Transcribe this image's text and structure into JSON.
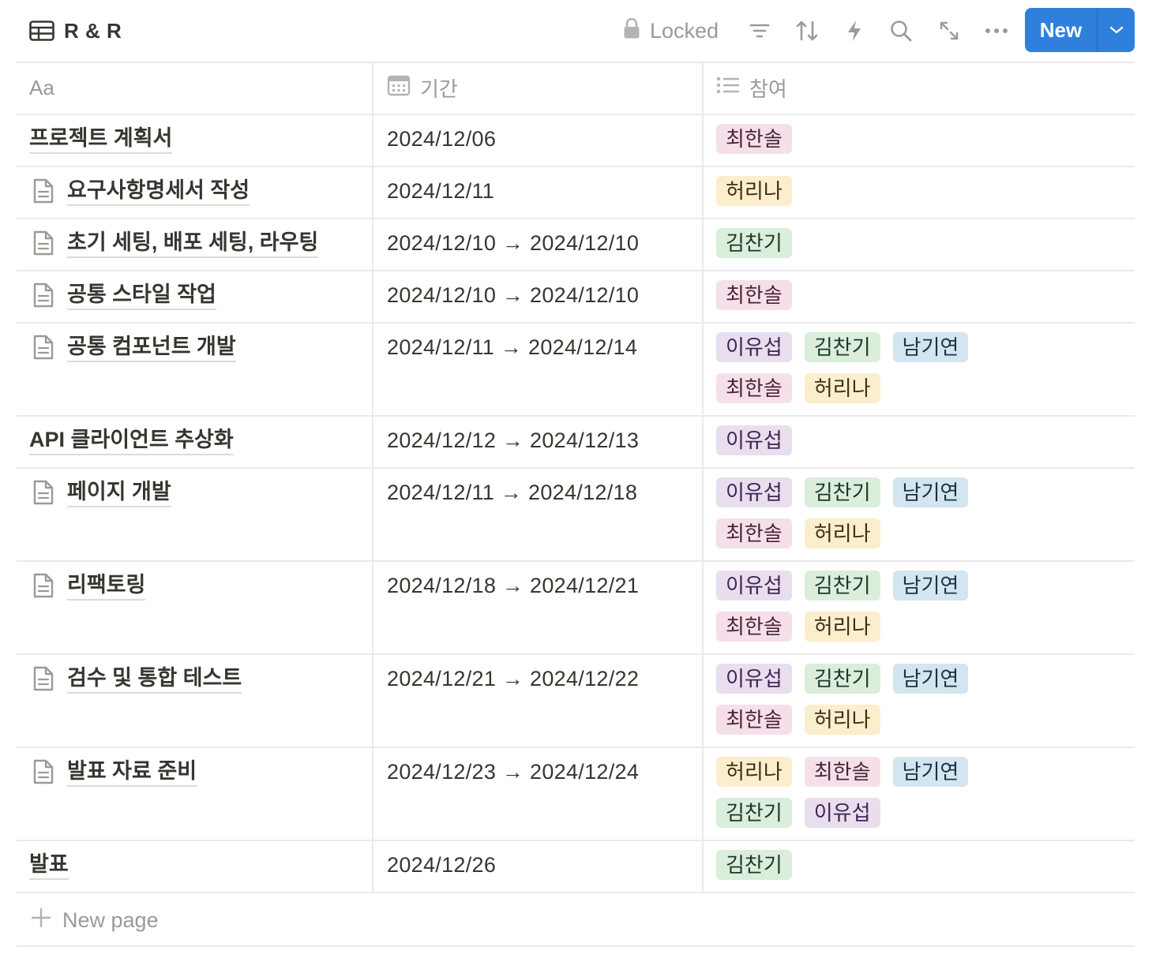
{
  "header": {
    "title": "R & R",
    "locked_label": "Locked",
    "new_button_label": "New"
  },
  "columns": {
    "name_header": "Aa",
    "date_header": "기간",
    "members_header": "참여"
  },
  "tag_colors": {
    "이유섭": {
      "bg": "#e8deee",
      "fg": "#412454"
    },
    "김찬기": {
      "bg": "#dbeddb",
      "fg": "#1c3829"
    },
    "남기연": {
      "bg": "#d3e5ef",
      "fg": "#183347"
    },
    "최한솔": {
      "bg": "#f5e0e9",
      "fg": "#4c2337"
    },
    "허리나": {
      "bg": "#fbeecc",
      "fg": "#402c1b"
    }
  },
  "rows": [
    {
      "name": "프로젝트 계획서",
      "has_icon": false,
      "date": "2024/12/06",
      "members": [
        "최한솔"
      ]
    },
    {
      "name": "요구사항명세서 작성",
      "has_icon": true,
      "date": "2024/12/11",
      "members": [
        "허리나"
      ]
    },
    {
      "name": "초기 세팅, 배포 세팅, 라우팅",
      "has_icon": true,
      "date": "2024/12/10 → 2024/12/10",
      "members": [
        "김찬기"
      ]
    },
    {
      "name": "공통 스타일 작업",
      "has_icon": true,
      "date": "2024/12/10 → 2024/12/10",
      "members": [
        "최한솔"
      ]
    },
    {
      "name": "공통 컴포넌트 개발",
      "has_icon": true,
      "date": "2024/12/11 → 2024/12/14",
      "members": [
        "이유섭",
        "김찬기",
        "남기연",
        "최한솔",
        "허리나"
      ]
    },
    {
      "name": "API 클라이언트 추상화",
      "has_icon": false,
      "date": "2024/12/12 → 2024/12/13",
      "members": [
        "이유섭"
      ]
    },
    {
      "name": "페이지 개발",
      "has_icon": true,
      "date": "2024/12/11 → 2024/12/18",
      "members": [
        "이유섭",
        "김찬기",
        "남기연",
        "최한솔",
        "허리나"
      ]
    },
    {
      "name": "리팩토링",
      "has_icon": true,
      "date": "2024/12/18 → 2024/12/21",
      "members": [
        "이유섭",
        "김찬기",
        "남기연",
        "최한솔",
        "허리나"
      ]
    },
    {
      "name": "검수 및 통합 테스트",
      "has_icon": true,
      "date": "2024/12/21 → 2024/12/22",
      "members": [
        "이유섭",
        "김찬기",
        "남기연",
        "최한솔",
        "허리나"
      ]
    },
    {
      "name": "발표 자료 준비",
      "has_icon": true,
      "date": "2024/12/23 → 2024/12/24",
      "members": [
        "허리나",
        "최한솔",
        "남기연",
        "김찬기",
        "이유섭"
      ]
    },
    {
      "name": "발표",
      "has_icon": false,
      "date": "2024/12/26",
      "members": [
        "김찬기"
      ]
    }
  ],
  "footer": {
    "new_page_label": "New page"
  }
}
